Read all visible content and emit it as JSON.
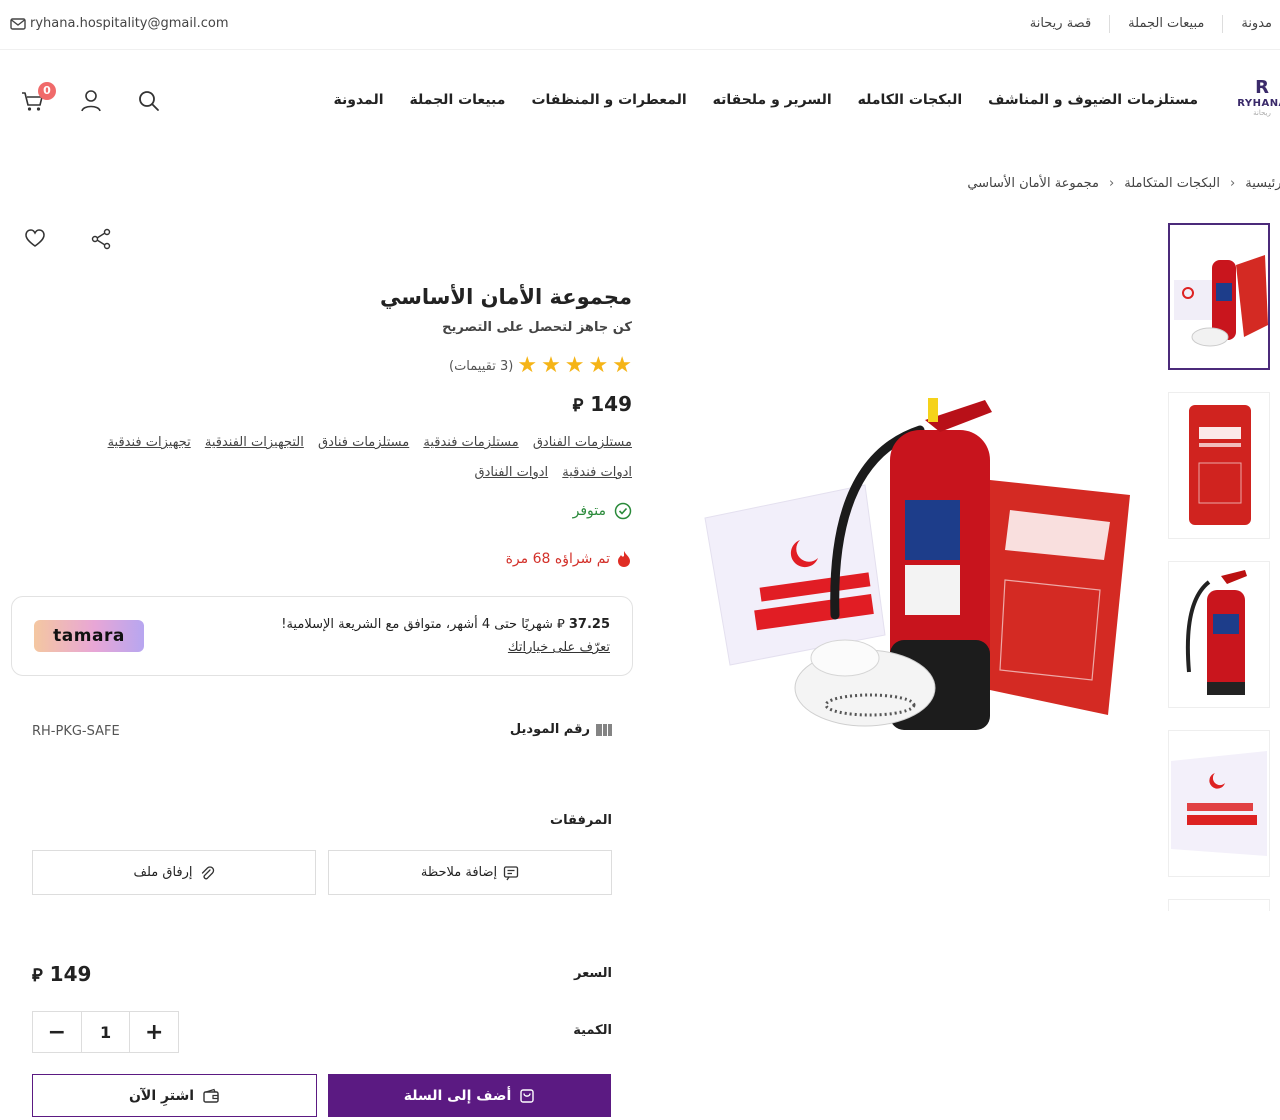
{
  "topbar": {
    "email": "ryhana.hospitality@gmail.com",
    "links": [
      "مدونة",
      "مبيعات الجملة",
      "قصة ريحانة"
    ]
  },
  "header": {
    "logo_mark": "R",
    "logo_name": "RYHANA",
    "logo_sub": "ريحانة",
    "nav": [
      "مستلزمات الضيوف و المناشف",
      "البكجات الكامله",
      "السرير و ملحقاته",
      "المعطرات و المنظفات",
      "مبيعات الجملة",
      "المدونة"
    ],
    "cart_count": "0"
  },
  "breadcrumb": [
    "الرئيسية",
    "البكجات المتكاملة",
    "مجموعة الأمان الأساسي"
  ],
  "breadcrumb_sep": "‹",
  "product": {
    "title": "مجموعة الأمان الأساسي",
    "subtitle": "كن جاهز لتحصل على التصريح",
    "rating_stars": 5,
    "rating_text": "(3 تقييمات)",
    "price": "149",
    "currency_symbol": "⃁",
    "tags": [
      "مستلزمات الفنادق",
      "مستلزمات فندقية",
      "مستلزمات فنادق",
      "التجهيزات الفندقية",
      "تجهيزات فندقية",
      "ادوات فندقية",
      "ادوات الفنادق"
    ],
    "stock": "متوفر",
    "sold": "تم شراؤه 68 مرة"
  },
  "tamara": {
    "amount": "37.25",
    "text": "شهريًا حتى 4 أشهر، متوافق مع الشريعة الإسلامية!",
    "learn": "تعرّف على خياراتك",
    "logo": "tamara"
  },
  "model": {
    "label": "رقم الموديل",
    "value": "RH-PKG-SAFE"
  },
  "attachments": {
    "title": "المرفقات",
    "add_note": "إضافة ملاحظة",
    "attach_file": "إرفاق ملف"
  },
  "purchase": {
    "price_label": "السعر",
    "price_value": "149",
    "qty_label": "الكمية",
    "qty_value": "1",
    "add_to_cart": "أضف إلى السلة",
    "buy_now": "اشترِ الآن"
  },
  "colors": {
    "brand": "#5b1a82",
    "star": "#f5b417",
    "in_stock": "#2a8a3a",
    "sold": "#d3312a"
  }
}
